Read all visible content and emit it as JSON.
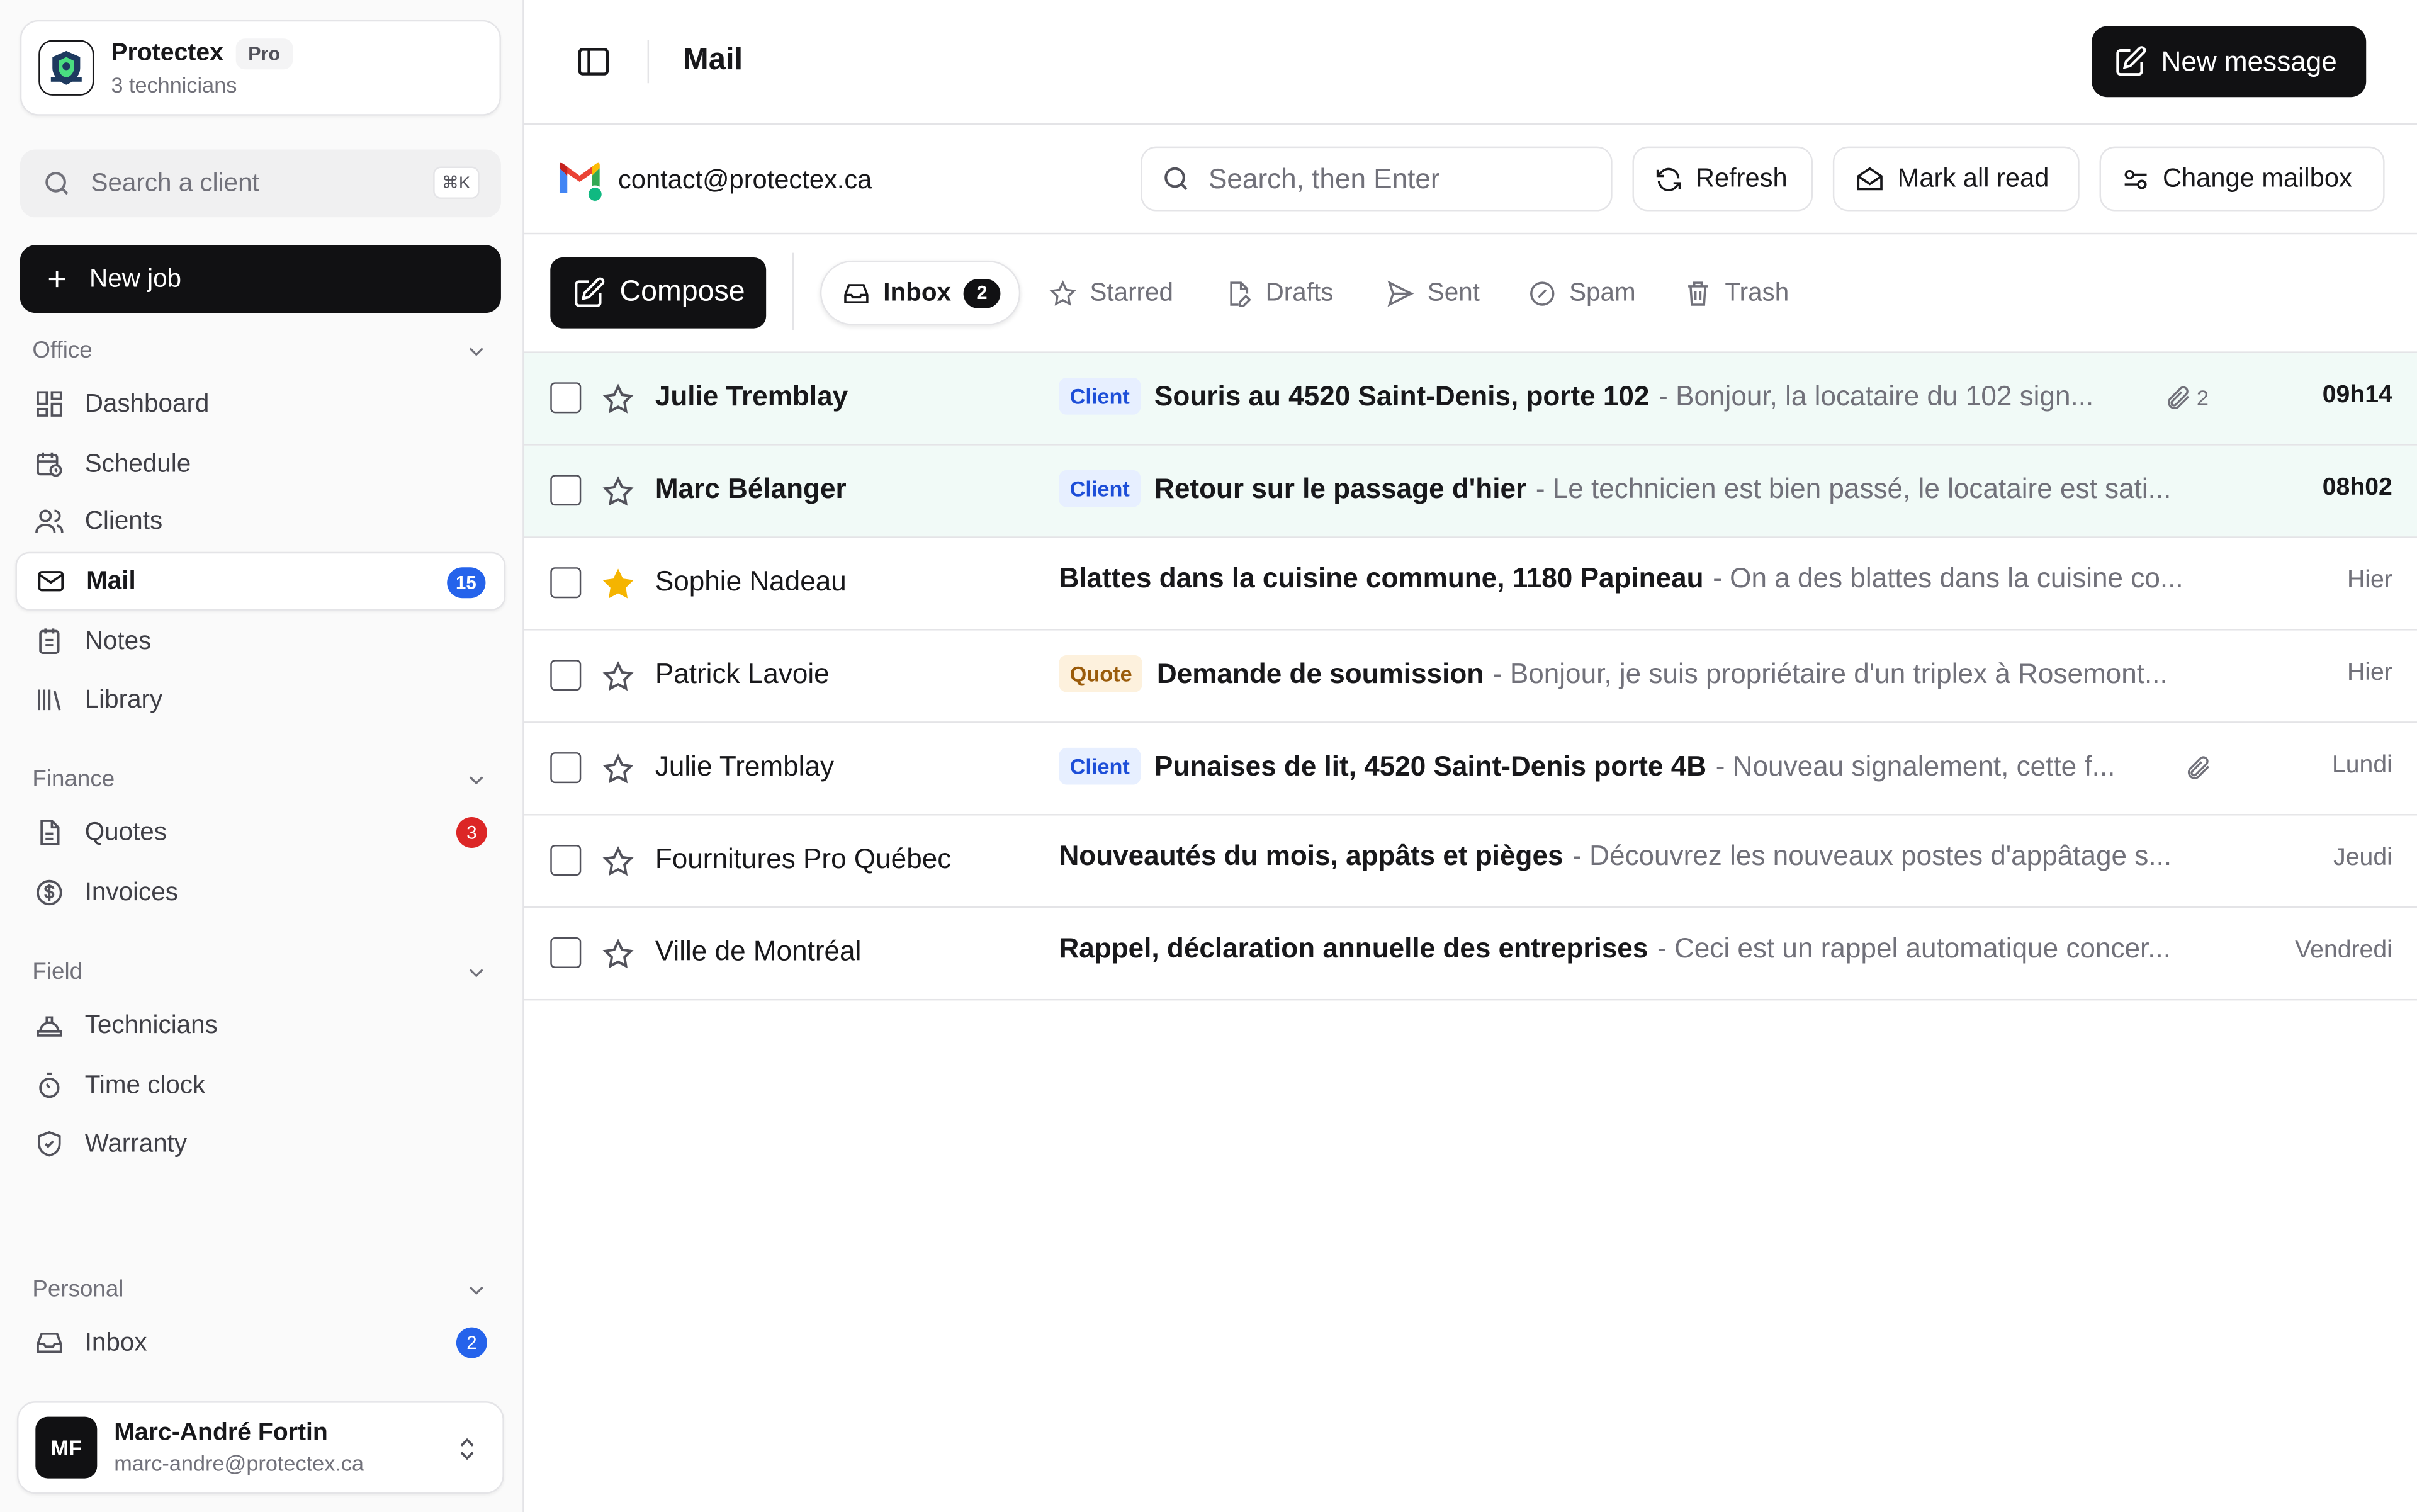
{
  "org": {
    "name": "Protectex",
    "plan": "Pro",
    "subtitle": "3 technicians"
  },
  "sidebar": {
    "search_placeholder": "Search a client",
    "search_shortcut": "⌘K",
    "new_job_label": "New job",
    "sections": {
      "office": "Office",
      "finance": "Finance",
      "field": "Field",
      "personal": "Personal"
    },
    "items": {
      "dashboard": "Dashboard",
      "schedule": "Schedule",
      "clients": "Clients",
      "mail": "Mail",
      "mail_count": "15",
      "notes": "Notes",
      "library": "Library",
      "quotes": "Quotes",
      "quotes_count": "3",
      "invoices": "Invoices",
      "technicians": "Technicians",
      "time_clock": "Time clock",
      "warranty": "Warranty",
      "inbox": "Inbox",
      "inbox_count": "2"
    }
  },
  "user": {
    "initials": "MF",
    "name": "Marc-André Fortin",
    "email": "marc-andre@protectex.ca"
  },
  "header": {
    "title": "Mail",
    "new_message_label": "New message"
  },
  "mailbox": {
    "account": "contact@protectex.ca",
    "search_placeholder": "Search, then Enter",
    "refresh_label": "Refresh",
    "mark_all_read_label": "Mark all read",
    "change_mailbox_label": "Change mailbox"
  },
  "tabs": {
    "compose": "Compose",
    "inbox": "Inbox",
    "inbox_count": "2",
    "starred": "Starred",
    "drafts": "Drafts",
    "sent": "Sent",
    "spam": "Spam",
    "trash": "Trash"
  },
  "emails": [
    {
      "sender": "Julie Tremblay",
      "tag": "Client",
      "subject": "Souris au 4520 Saint-Denis, porte 102",
      "preview": "- Bonjour, la locataire du 102 sign...",
      "attachments": "2",
      "date": "09h14"
    },
    {
      "sender": "Marc Bélanger",
      "tag": "Client",
      "subject": "Retour sur le passage d'hier",
      "preview": "- Le technicien est bien passé, le locataire est sati...",
      "date": "08h02"
    },
    {
      "sender": "Sophie Nadeau",
      "subject": "Blattes dans la cuisine commune, 1180 Papineau",
      "preview": "- On a des blattes dans la cuisine co...",
      "date": "Hier"
    },
    {
      "sender": "Patrick Lavoie",
      "tag": "Quote",
      "subject": "Demande de soumission",
      "preview": "- Bonjour, je suis propriétaire d'un triplex à Rosemont...",
      "date": "Hier"
    },
    {
      "sender": "Julie Tremblay",
      "tag": "Client",
      "subject": "Punaises de lit, 4520 Saint-Denis porte 4B",
      "preview": "- Nouveau signalement, cette f...",
      "date": "Lundi"
    },
    {
      "sender": "Fournitures Pro Québec",
      "subject": "Nouveautés du mois, appâts et pièges",
      "preview": "- Découvrez les nouveaux postes d'appâtage s...",
      "date": "Jeudi"
    },
    {
      "sender": "Ville de Montréal",
      "subject": "Rappel, déclaration annuelle des entreprises",
      "preview": "- Ceci est un rappel automatique concer...",
      "date": "Vendredi"
    }
  ],
  "colors": {
    "accent": "#111113",
    "unread_bg": "#f1faf7",
    "badge_blue": "#2563eb",
    "badge_red": "#dc2626",
    "star_filled": "#f5b400"
  }
}
